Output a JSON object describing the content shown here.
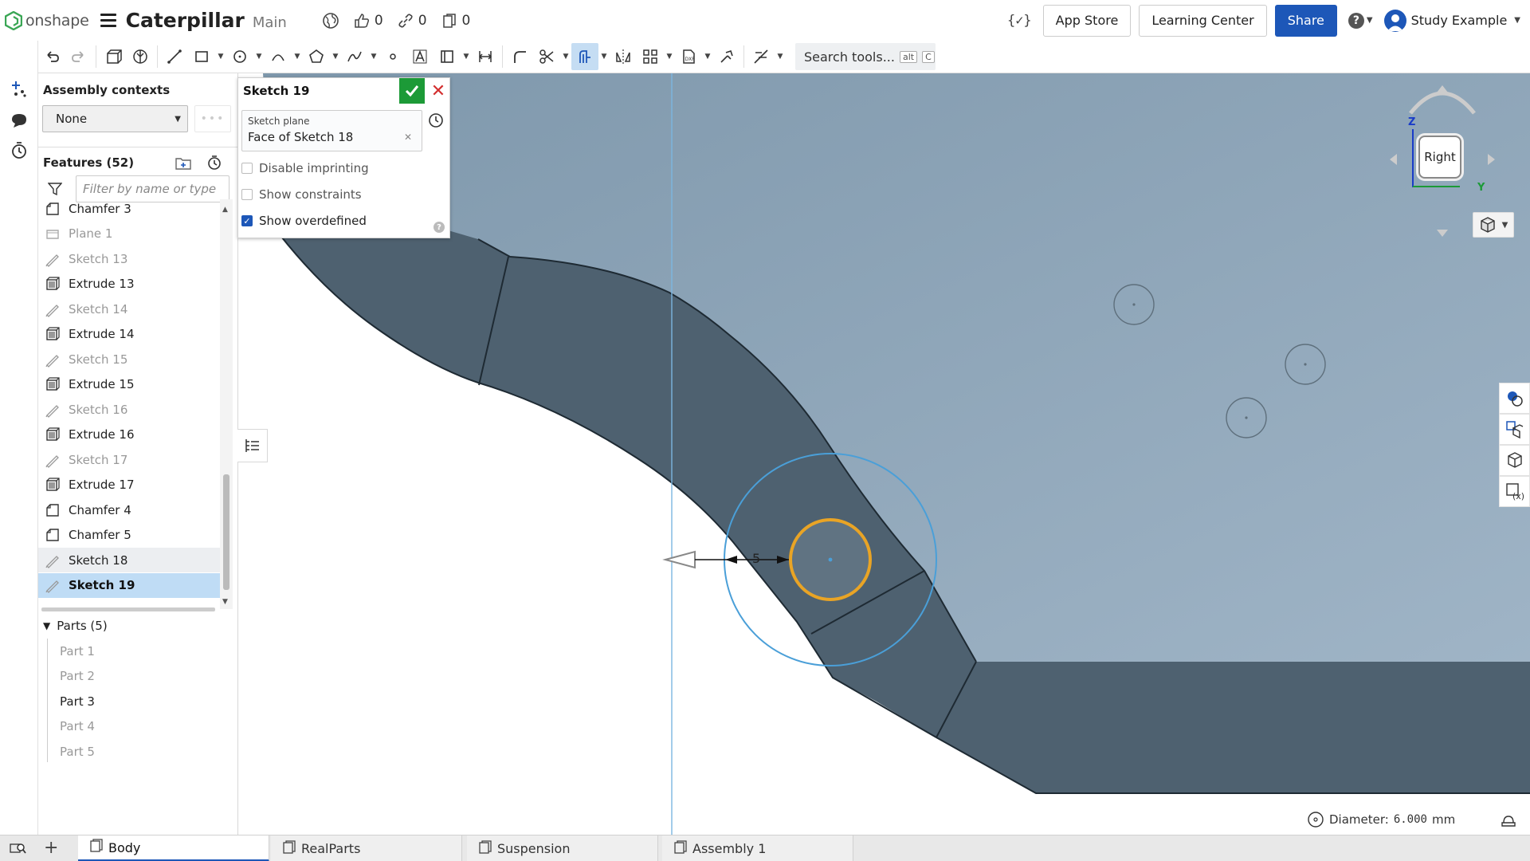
{
  "app": {
    "logo_text": "onshape",
    "doc_title": "Caterpillar",
    "branch": "Main",
    "stats": {
      "likes": "0",
      "links": "0",
      "copies": "0"
    }
  },
  "header": {
    "variable_icon": "{✓}",
    "app_store": "App Store",
    "learning_center": "Learning Center",
    "share": "Share",
    "user": "Study Example"
  },
  "toolbar": {
    "search_label": "Search tools...",
    "kbd1": "alt",
    "kbd2": "C"
  },
  "assembly": {
    "title": "Assembly contexts",
    "selected": "None"
  },
  "features": {
    "title": "Features (52)",
    "filter_placeholder": "Filter by name or type",
    "items": [
      {
        "label": "Chamfer 3",
        "icon": "chamfer-icon",
        "state": "normal"
      },
      {
        "label": "Plane 1",
        "icon": "plane-icon",
        "state": "dim"
      },
      {
        "label": "Sketch 13",
        "icon": "sketch-icon",
        "state": "dim"
      },
      {
        "label": "Extrude 13",
        "icon": "extrude-icon",
        "state": "normal"
      },
      {
        "label": "Sketch 14",
        "icon": "sketch-icon",
        "state": "dim"
      },
      {
        "label": "Extrude 14",
        "icon": "extrude-icon",
        "state": "normal"
      },
      {
        "label": "Sketch 15",
        "icon": "sketch-icon",
        "state": "dim"
      },
      {
        "label": "Extrude 15",
        "icon": "extrude-icon",
        "state": "normal"
      },
      {
        "label": "Sketch 16",
        "icon": "sketch-icon",
        "state": "dim"
      },
      {
        "label": "Extrude 16",
        "icon": "extrude-icon",
        "state": "normal"
      },
      {
        "label": "Sketch 17",
        "icon": "sketch-icon",
        "state": "dim"
      },
      {
        "label": "Extrude 17",
        "icon": "extrude-icon",
        "state": "normal"
      },
      {
        "label": "Chamfer 4",
        "icon": "chamfer-icon",
        "state": "normal"
      },
      {
        "label": "Chamfer 5",
        "icon": "chamfer-icon",
        "state": "normal"
      },
      {
        "label": "Sketch 18",
        "icon": "sketch-icon",
        "state": "hover"
      },
      {
        "label": "Sketch 19",
        "icon": "sketch-icon",
        "state": "selected"
      }
    ]
  },
  "parts": {
    "title": "Parts (5)",
    "items": [
      {
        "label": "Part 1",
        "visible": false
      },
      {
        "label": "Part 2",
        "visible": false
      },
      {
        "label": "Part 3",
        "visible": true
      },
      {
        "label": "Part 4",
        "visible": false
      },
      {
        "label": "Part 5",
        "visible": false
      }
    ]
  },
  "sketch_dialog": {
    "title": "Sketch 19",
    "plane_label": "Sketch plane",
    "plane_value": "Face of Sketch 18",
    "options": [
      {
        "label": "Disable imprinting",
        "checked": false
      },
      {
        "label": "Show constraints",
        "checked": false
      },
      {
        "label": "Show overdefined",
        "checked": true
      }
    ]
  },
  "viewport": {
    "view_cube_face": "Right",
    "axis_z": "Z",
    "axis_y": "Y",
    "dimension_value": "5"
  },
  "status": {
    "label": "Diameter:",
    "value": "6.000",
    "unit": "mm"
  },
  "tabs": [
    {
      "label": "Body",
      "active": true
    },
    {
      "label": "RealParts",
      "active": false
    },
    {
      "label": "Suspension",
      "active": false
    },
    {
      "label": "Assembly 1",
      "active": false
    }
  ],
  "colors": {
    "accent": "#1d57b8",
    "ok_green": "#1c9a37",
    "cancel_red": "#d32f2f",
    "body_face": "#8aa4b8",
    "body_dark": "#4e6170",
    "selected_circle": "#e9a425",
    "preview_circle": "#4a9fd8"
  }
}
